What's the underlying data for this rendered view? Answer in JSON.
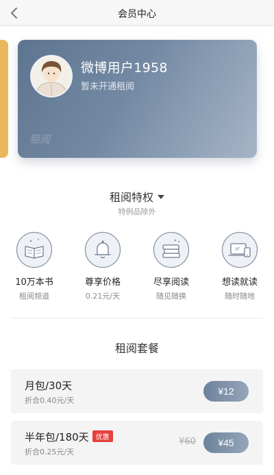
{
  "header": {
    "title": "会员中心",
    "back_icon": "chevron-left-icon"
  },
  "card": {
    "user_name": "微博用户1958",
    "status": "暂未开通租阅",
    "watermark": "租阅",
    "gradient": [
      "#5e7591",
      "#a6b5c7"
    ],
    "side_card_color": "#e9b85a"
  },
  "privileges": {
    "title": "租阅特权",
    "subtitle": "特例品除外",
    "items": [
      {
        "icon": "book-icon",
        "title": "10万本书",
        "desc": "租阅频道"
      },
      {
        "icon": "bell-icon",
        "title": "尊享价格",
        "desc": "0.21元/天"
      },
      {
        "icon": "book-stack-icon",
        "title": "尽享阅读",
        "desc": "随见随换"
      },
      {
        "icon": "devices-icon",
        "title": "想读就读",
        "desc": "随时随地"
      }
    ]
  },
  "packages": {
    "title": "租阅套餐",
    "items": [
      {
        "name": "月包/30天",
        "note": "折合0.40元/天",
        "price": "¥12"
      },
      {
        "name": "半年包/180天",
        "badge": "优惠",
        "note": "折合0.25元/天",
        "old_price": "¥60",
        "price": "¥45"
      }
    ]
  },
  "colors": {
    "accent": "#7389a3",
    "badge": "#e8413c"
  }
}
